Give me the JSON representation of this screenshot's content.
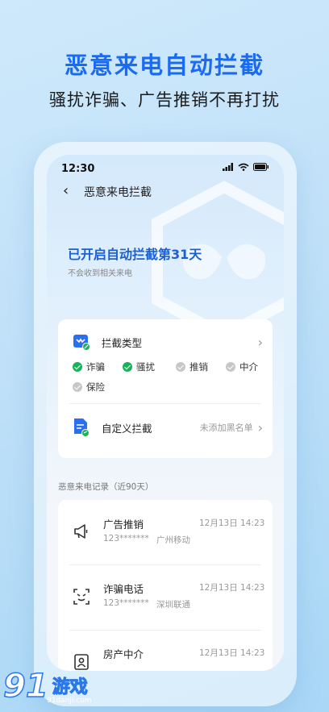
{
  "promo": {
    "title": "恶意来电自动拦截",
    "subtitle": "骚扰诈骗、广告推销不再打扰"
  },
  "status_bar": {
    "time": "12:30"
  },
  "nav": {
    "title": "恶意来电拦截"
  },
  "banner": {
    "title": "已开启自动拦截第31天",
    "subtitle": "不会收到相关来电"
  },
  "block_types": {
    "label": "拦截类型",
    "items": [
      {
        "label": "诈骗",
        "enabled": true
      },
      {
        "label": "骚扰",
        "enabled": true
      },
      {
        "label": "推销",
        "enabled": false
      },
      {
        "label": "中介",
        "enabled": false
      },
      {
        "label": "保险",
        "enabled": false
      }
    ]
  },
  "custom_block": {
    "label": "自定义拦截",
    "status": "未添加黑名单"
  },
  "records": {
    "section_title": "恶意来电记录（近90天）",
    "items": [
      {
        "title": "广告推销",
        "number": "123*******",
        "carrier": "广州移动",
        "time": "12月13日 14:23",
        "icon": "megaphone-icon"
      },
      {
        "title": "诈骗电话",
        "number": "123*******",
        "carrier": "深圳联通",
        "time": "12月13日 14:23",
        "icon": "scam-mask-icon"
      },
      {
        "title": "房产中介",
        "number": "",
        "carrier": "",
        "time": "12月13日 14:23",
        "icon": "house-agent-icon"
      }
    ]
  },
  "watermark": {
    "number": "91",
    "text": "游戏",
    "url": "91danji.com"
  },
  "colors": {
    "accent": "#1a6bf2",
    "enabled": "#19b25a",
    "disabled": "#c7c7c7"
  }
}
